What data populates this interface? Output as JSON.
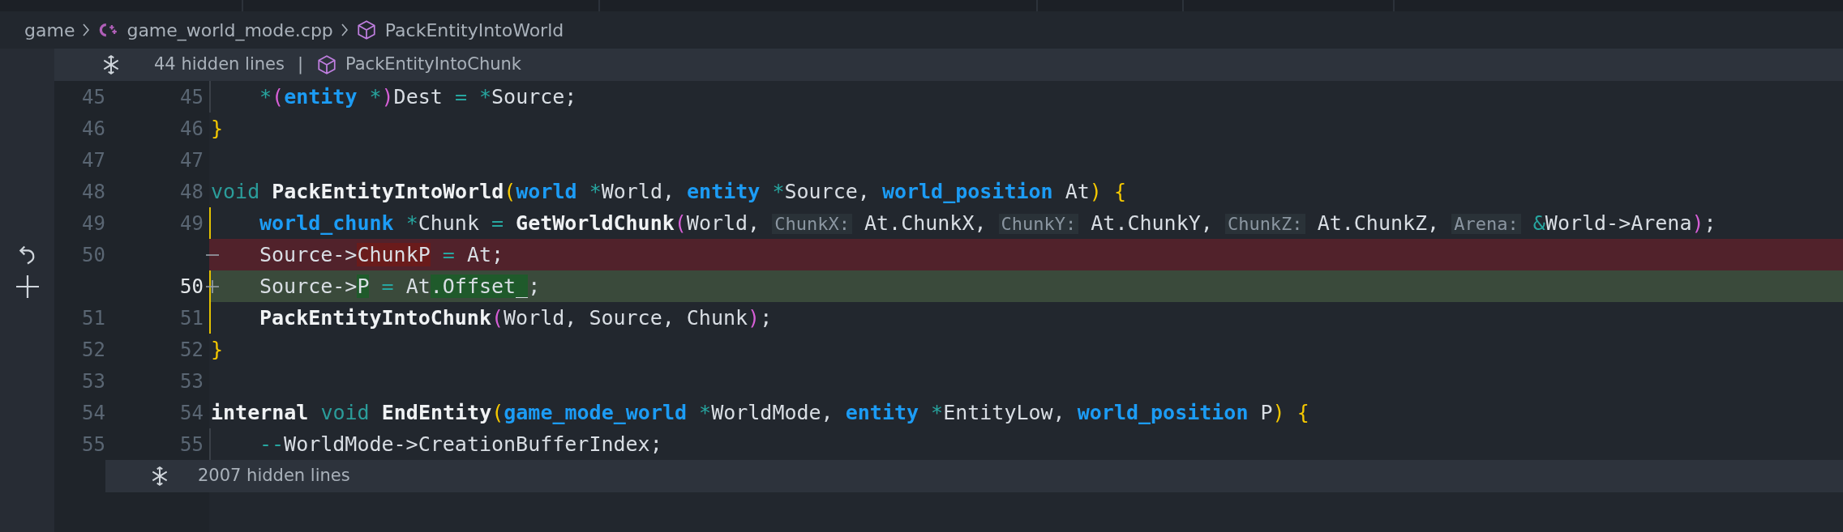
{
  "breadcrumb": [
    {
      "text": "game",
      "kind": "folder"
    },
    {
      "text": "game_world_mode.cpp",
      "kind": "file"
    },
    {
      "text": "PackEntityIntoWorld",
      "kind": "symbol"
    }
  ],
  "fold_top": {
    "text": "44 hidden lines",
    "separator": "|",
    "symbol": "PackEntityIntoChunk"
  },
  "lines": [
    {
      "old": "45",
      "new": "45",
      "kind": "context",
      "indented": true,
      "bracket_highlight": false,
      "tokens": [
        {
          "kind": "op",
          "text": "*"
        },
        {
          "kind": "br2",
          "text": "("
        },
        {
          "kind": "type",
          "text": "entity "
        },
        {
          "kind": "op",
          "text": "*"
        },
        {
          "kind": "br2",
          "text": ")"
        },
        {
          "kind": "id",
          "text": "Dest "
        },
        {
          "kind": "op",
          "text": "= "
        },
        {
          "kind": "op",
          "text": "*"
        },
        {
          "kind": "id",
          "text": "Source;"
        }
      ]
    },
    {
      "old": "46",
      "new": "46",
      "kind": "context",
      "bracket_highlight": false,
      "tokens": [
        {
          "kind": "br1",
          "text": "}"
        }
      ]
    },
    {
      "old": "47",
      "new": "47",
      "kind": "context",
      "bracket_highlight": false
    },
    {
      "old": "48",
      "new": "48",
      "kind": "context",
      "bracket_highlight": false,
      "tokens": [
        {
          "kind": "kw",
          "text": "void "
        },
        {
          "kind": "fn",
          "text": "PackEntityIntoWorld"
        },
        {
          "kind": "br1",
          "text": "("
        },
        {
          "kind": "type",
          "text": "world "
        },
        {
          "kind": "op",
          "text": "*"
        },
        {
          "kind": "id",
          "text": "World, "
        },
        {
          "kind": "type",
          "text": "entity "
        },
        {
          "kind": "op",
          "text": "*"
        },
        {
          "kind": "id",
          "text": "Source, "
        },
        {
          "kind": "type",
          "text": "world_position "
        },
        {
          "kind": "id",
          "text": "At"
        },
        {
          "kind": "br1",
          "text": ") {"
        }
      ]
    },
    {
      "old": "49",
      "new": "49",
      "kind": "context",
      "indented": true,
      "bracket_highlight": true,
      "tokens": [
        {
          "kind": "type",
          "text": "world_chunk "
        },
        {
          "kind": "op",
          "text": "*"
        },
        {
          "kind": "id",
          "text": "Chunk "
        },
        {
          "kind": "op",
          "text": "= "
        },
        {
          "kind": "fn",
          "text": "GetWorldChunk"
        },
        {
          "kind": "br2",
          "text": "("
        },
        {
          "kind": "id",
          "text": "World, "
        },
        {
          "kind": "hint",
          "text": "ChunkX:"
        },
        {
          "kind": "id",
          "text": " At.ChunkX, "
        },
        {
          "kind": "hint",
          "text": "ChunkY:"
        },
        {
          "kind": "id",
          "text": " At.ChunkY, "
        },
        {
          "kind": "hint",
          "text": "ChunkZ:"
        },
        {
          "kind": "id",
          "text": " At.ChunkZ, "
        },
        {
          "kind": "hint",
          "text": "Arena:"
        },
        {
          "kind": "op",
          "text": " &"
        },
        {
          "kind": "id",
          "text": "World->Arena"
        },
        {
          "kind": "br2",
          "text": ")"
        },
        {
          "kind": "id",
          "text": ";"
        }
      ]
    },
    {
      "old": "50",
      "kind": "removed",
      "indented": true,
      "bracket_highlight": false,
      "tokens": [
        {
          "kind": "id",
          "text": "Source->"
        },
        {
          "kind": "del",
          "text": "ChunkP"
        },
        {
          "kind": "op",
          "text": " = "
        },
        {
          "kind": "id",
          "text": "At;"
        }
      ]
    },
    {
      "new": "50",
      "kind": "added",
      "indented": true,
      "bracket_highlight": true,
      "tokens": [
        {
          "kind": "id",
          "text": "Source->"
        },
        {
          "kind": "ins",
          "text": "P"
        },
        {
          "kind": "op",
          "text": " = "
        },
        {
          "kind": "id",
          "text": "At"
        },
        {
          "kind": "ins",
          "text": ".Offset_"
        },
        {
          "kind": "id",
          "text": ";"
        }
      ]
    },
    {
      "old": "51",
      "new": "51",
      "kind": "context",
      "indented": true,
      "bracket_highlight": true,
      "tokens": [
        {
          "kind": "fn",
          "text": "PackEntityIntoChunk"
        },
        {
          "kind": "br2",
          "text": "("
        },
        {
          "kind": "id",
          "text": "World, Source, Chunk"
        },
        {
          "kind": "br2",
          "text": ")"
        },
        {
          "kind": "id",
          "text": ";"
        }
      ]
    },
    {
      "old": "52",
      "new": "52",
      "kind": "context",
      "bracket_highlight": false,
      "tokens": [
        {
          "kind": "br1",
          "text": "}"
        }
      ]
    },
    {
      "old": "53",
      "new": "53",
      "kind": "context",
      "bracket_highlight": false
    },
    {
      "old": "54",
      "new": "54",
      "kind": "context",
      "bracket_highlight": false,
      "tokens": [
        {
          "kind": "kwb",
          "text": "internal "
        },
        {
          "kind": "kw",
          "text": "void "
        },
        {
          "kind": "fn",
          "text": "EndEntity"
        },
        {
          "kind": "br1",
          "text": "("
        },
        {
          "kind": "type",
          "text": "game_mode_world "
        },
        {
          "kind": "op",
          "text": "*"
        },
        {
          "kind": "id",
          "text": "WorldMode, "
        },
        {
          "kind": "type",
          "text": "entity "
        },
        {
          "kind": "op",
          "text": "*"
        },
        {
          "kind": "id",
          "text": "EntityLow, "
        },
        {
          "kind": "type",
          "text": "world_position "
        },
        {
          "kind": "id",
          "text": "P"
        },
        {
          "kind": "br1",
          "text": ") {"
        }
      ]
    },
    {
      "old": "55",
      "new": "55",
      "kind": "context",
      "indented": true,
      "bracket_highlight": false,
      "tokens": [
        {
          "kind": "op",
          "text": "--"
        },
        {
          "kind": "id",
          "text": "WorldMode->CreationBufferIndex;"
        }
      ]
    }
  ],
  "fold_bottom": {
    "text": "2007 hidden lines"
  }
}
